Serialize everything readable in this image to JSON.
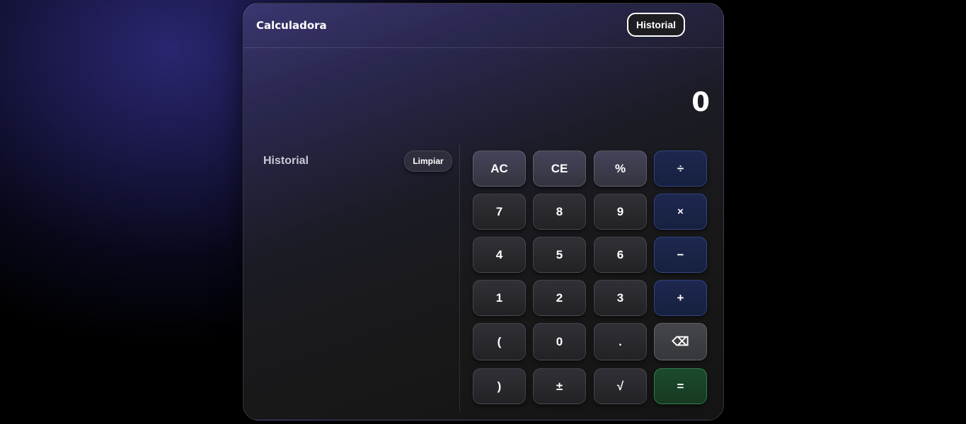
{
  "header": {
    "title": "Calculadora",
    "history_toggle_label": "Historial",
    "theme_icon": "moon-icon"
  },
  "display": {
    "value": "0"
  },
  "history": {
    "title": "Historial",
    "clear_label": "Limpiar",
    "entries": []
  },
  "keypad": {
    "keys": [
      {
        "label": "AC",
        "type": "function"
      },
      {
        "label": "CE",
        "type": "function"
      },
      {
        "label": "%",
        "type": "function"
      },
      {
        "label": "÷",
        "type": "operator"
      },
      {
        "label": "7",
        "type": "digit"
      },
      {
        "label": "8",
        "type": "digit"
      },
      {
        "label": "9",
        "type": "digit"
      },
      {
        "label": "×",
        "type": "operator"
      },
      {
        "label": "4",
        "type": "digit"
      },
      {
        "label": "5",
        "type": "digit"
      },
      {
        "label": "6",
        "type": "digit"
      },
      {
        "label": "−",
        "type": "operator"
      },
      {
        "label": "1",
        "type": "digit"
      },
      {
        "label": "2",
        "type": "digit"
      },
      {
        "label": "3",
        "type": "digit"
      },
      {
        "label": "+",
        "type": "operator"
      },
      {
        "label": "(",
        "type": "digit"
      },
      {
        "label": "0",
        "type": "digit"
      },
      {
        "label": ".",
        "type": "digit"
      },
      {
        "label": "⌫",
        "type": "backspace"
      },
      {
        "label": ")",
        "type": "digit"
      },
      {
        "label": "±",
        "type": "digit"
      },
      {
        "label": "√",
        "type": "digit"
      },
      {
        "label": "=",
        "type": "equals"
      }
    ]
  },
  "colors": {
    "operator_key": "#1e2850",
    "equals_key": "#1d4a2c",
    "function_key": "#44445a",
    "accent_background": "#2a2670"
  }
}
